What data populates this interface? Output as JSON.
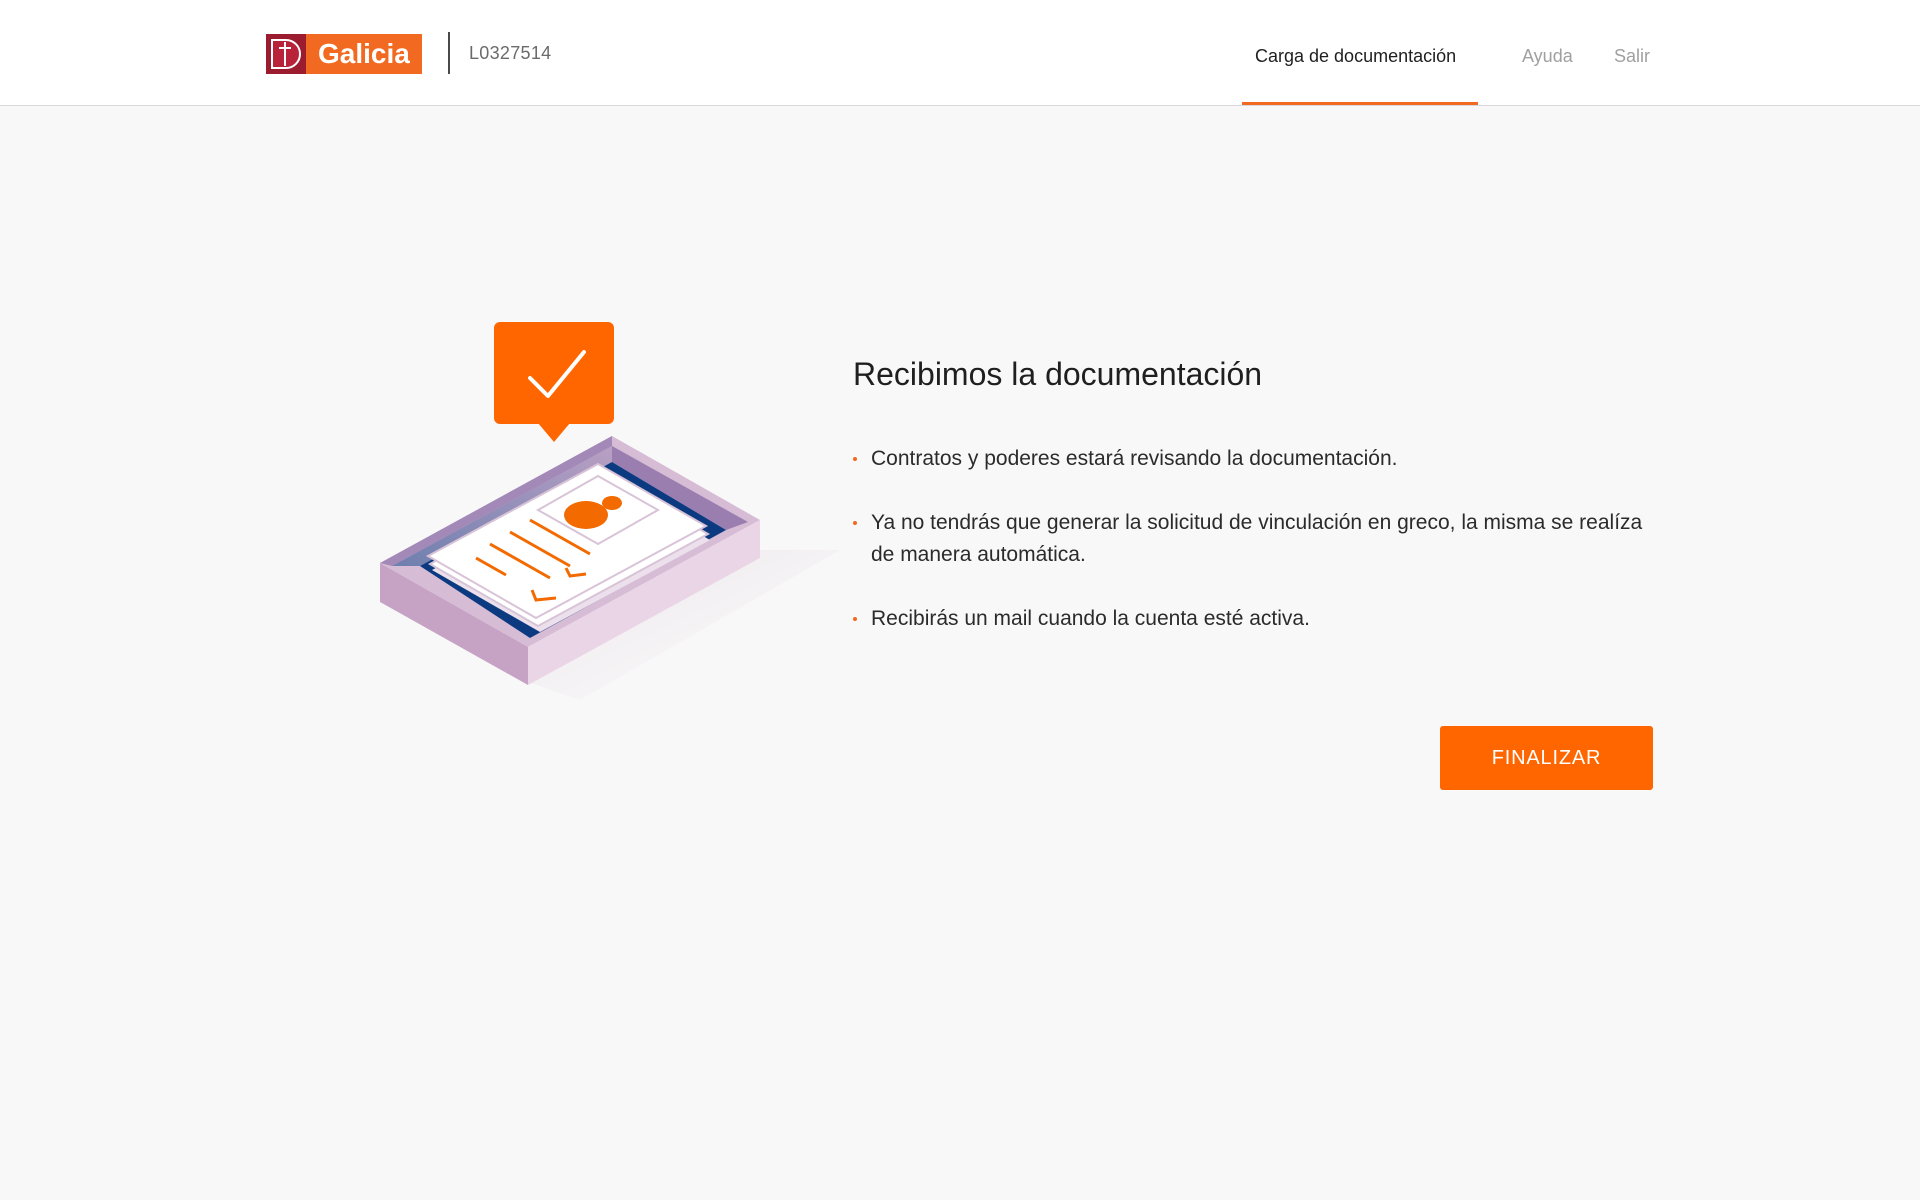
{
  "header": {
    "logo_text": "Galicia",
    "user_code": "L0327514",
    "nav": {
      "active": "Carga de documentación",
      "help": "Ayuda",
      "exit": "Salir"
    }
  },
  "main": {
    "title": "Recibimos la documentación",
    "bullets": [
      "Contratos y poderes estará revisando la documentación.",
      "Ya no tendrás que generar la solicitud de vinculación en greco, la misma se realíza de manera automática.",
      "Recibirás un mail cuando la cuenta esté activa."
    ],
    "finish_label": "FINALIZAR"
  },
  "icons": {
    "illustration": "document-tray-check-illustration",
    "check": "check-icon"
  },
  "colors": {
    "accent": "#ff6600",
    "brand_red": "#9a1c2e",
    "brand_orange": "#f26a21",
    "background": "#f8f8f8"
  }
}
